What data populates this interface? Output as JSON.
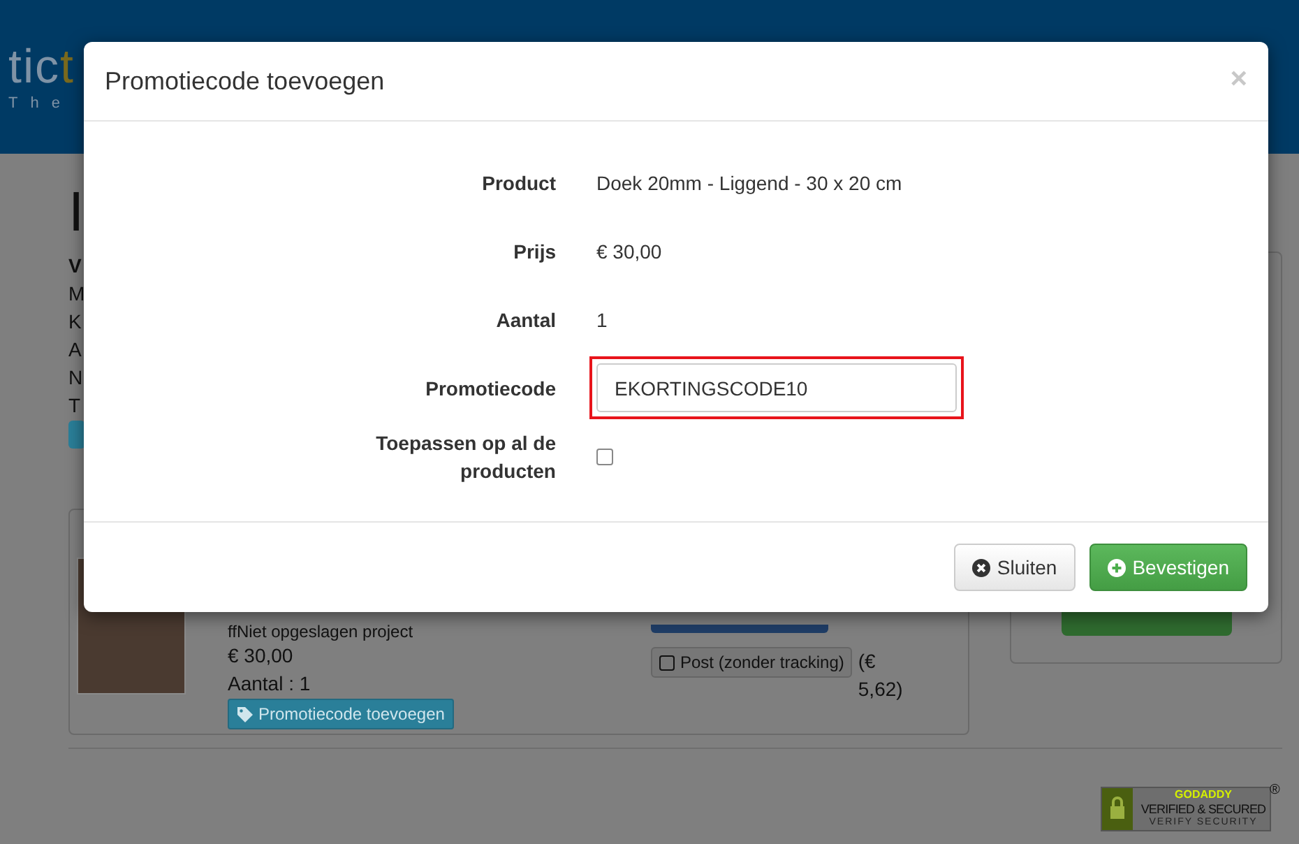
{
  "header": {
    "logo": [
      {
        "text": "tic",
        "kind": "plain"
      },
      {
        "text": "t",
        "kind": "accent"
      }
    ],
    "tagline": "The"
  },
  "page": {
    "heading": "I",
    "details": [
      {
        "text": "V",
        "kind": "label"
      },
      {
        "text": "M",
        "kind": "line"
      },
      {
        "text": "K",
        "kind": "line"
      },
      {
        "text": "A",
        "kind": "line"
      },
      {
        "text": "N",
        "kind": "line"
      },
      {
        "text": "T",
        "kind": "line"
      }
    ]
  },
  "cart_item": {
    "project": "ffNiet opgeslagen project",
    "price": "€ 30,00",
    "quantity": "Aantal : 1",
    "promo_button": "Promotiecode toevoegen",
    "shipping": {
      "option": "Post (zonder tracking)",
      "checked": false,
      "cost": "(€ 5,62)"
    }
  },
  "modal": {
    "title": "Promotiecode toevoegen",
    "close": "×",
    "fields": [
      {
        "label": "Product",
        "kind": "text",
        "value": "Doek 20mm - Liggend - 30 x 20 cm"
      },
      {
        "label": "Prijs",
        "kind": "text",
        "value": "€ 30,00"
      },
      {
        "label": "Aantal",
        "kind": "text",
        "value": "1"
      },
      {
        "label": "Promotiecode",
        "kind": "input",
        "value": "EKORTINGSCODE10",
        "highlighted": true
      },
      {
        "label": "Toepassen op al de producten",
        "kind": "checkbox",
        "checked": false
      }
    ],
    "buttons": [
      {
        "label": "Sluiten",
        "kind": "default"
      },
      {
        "label": "Bevestigen",
        "kind": "primary"
      }
    ]
  },
  "seal": {
    "brand": "GODADDY",
    "title": "VERIFIED & SECURED",
    "subtitle": "VERIFY SECURITY",
    "mark": "®"
  }
}
